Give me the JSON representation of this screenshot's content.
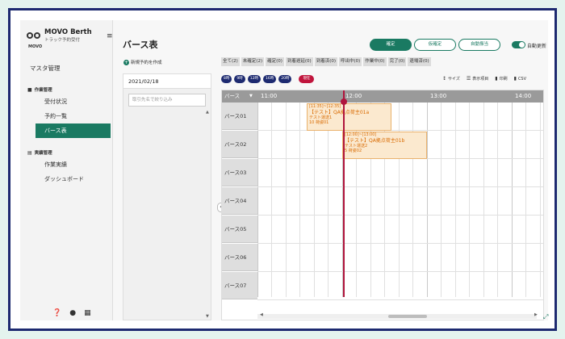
{
  "app": {
    "logo_name": "MOVO Berth",
    "logo_sub": "トラック予約受付",
    "logo_small": "MOVO",
    "menu_icon": "≡"
  },
  "sidebar": {
    "master": "マスタ管理",
    "group1": "作業管理",
    "group1_items": [
      "受付状況",
      "予約一覧",
      "バース表"
    ],
    "group2": "実績管理",
    "group2_items": [
      "作業実績",
      "ダッシュボード"
    ],
    "active_item": "バース表",
    "footer_icons": [
      "help-icon",
      "user-icon",
      "grid-icon"
    ]
  },
  "header": {
    "title": "バース表",
    "buttons": [
      "確定",
      "仮確定",
      "自動振当"
    ],
    "auto_update_label": "自動更新",
    "auto_update_on": true
  },
  "left_panel": {
    "new_reservation": "新規予約を作成",
    "date": "2021/02/18",
    "filter_placeholder": "取引先名で絞り込み"
  },
  "filter_tabs": [
    "全て(2)",
    "未確定(2)",
    "確定(0)",
    "到着遅延(0)",
    "到着済(0)",
    "呼出中(0)",
    "作業中(0)",
    "完了(0)",
    "退場済(0)"
  ],
  "hour_buttons": [
    "8時",
    "9時",
    "12時",
    "16時",
    "20時"
  ],
  "now_button": "現在",
  "tools": [
    {
      "label": "サイズ",
      "icon": "size-icon"
    },
    {
      "label": "表示項目",
      "icon": "list-icon"
    },
    {
      "label": "印刷",
      "icon": "print-icon"
    },
    {
      "label": "CSV",
      "icon": "csv-icon"
    }
  ],
  "grid": {
    "header_label": "バース",
    "times": [
      "11:00",
      "12:00",
      "13:00",
      "14:00"
    ],
    "berths": [
      "バース01",
      "バース02",
      "バース03",
      "バース04",
      "バース05",
      "バース06",
      "バース07"
    ]
  },
  "bookings": [
    {
      "time": "[11:35]~[12:35]",
      "title": "【テスト】QA拠点荷主01a",
      "line1": "テスト運送1",
      "line2": "10 荷姿01",
      "berth_index": 0,
      "start": "11:35",
      "end": "12:35"
    },
    {
      "time": "[12:00]~[13:00]",
      "title": "【テスト】QA拠点荷主01b",
      "line1": "テスト運送2",
      "line2": "5 荷姿02",
      "berth_index": 1,
      "start": "12:00",
      "end": "13:00"
    }
  ],
  "colors": {
    "accent": "#1a7a62",
    "navy": "#1d2a70",
    "now": "#b0143c",
    "booking_bg": "#fbe9cf",
    "booking_text": "#d96a00"
  }
}
